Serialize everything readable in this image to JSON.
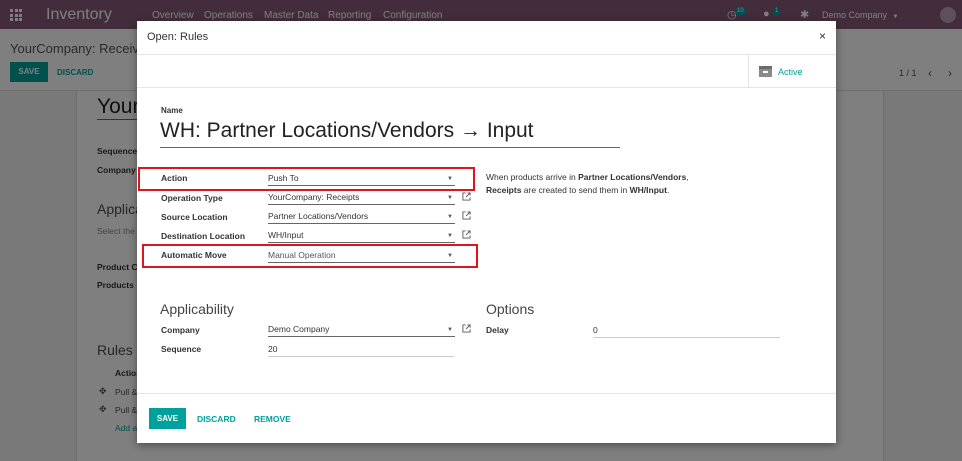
{
  "navbar": {
    "app_name": "Inventory",
    "menus": [
      "Overview",
      "Operations",
      "Master Data",
      "Reporting",
      "Configuration"
    ],
    "activity_count": "10",
    "messages_count": "1",
    "company": "Demo Company",
    "apps_icon": "grid-icon",
    "color": "#875a7b"
  },
  "background": {
    "breadcrumb": "YourCompany: Receive",
    "save_label": "SAVE",
    "discard_label": "DISCARD",
    "pager": "1 / 1",
    "heading_partial": "Your",
    "sequence_label": "Sequence",
    "company_label": "Company",
    "applic_partial": "Applica",
    "select_partial": "Select the",
    "product_cat_partial": "Product C",
    "products_label": "Products",
    "rules_title": "Rules",
    "action_col": "Action",
    "row1": "Pull &",
    "row2": "Pull &",
    "add_line": "Add a"
  },
  "modal": {
    "title": "Open: Rules",
    "close_glyph": "×",
    "active_label": "Active",
    "name_label": "Name",
    "name_value": "WH: Partner Locations/Vendors → Input",
    "fields": {
      "action": {
        "label": "Action",
        "value": "Push To"
      },
      "operation_type": {
        "label": "Operation Type",
        "value": "YourCompany: Receipts"
      },
      "source_location": {
        "label": "Source Location",
        "value": "Partner Locations/Vendors"
      },
      "destination_location": {
        "label": "Destination Location",
        "value": "WH/Input"
      },
      "automatic_move": {
        "label": "Automatic Move",
        "value": "Manual Operation"
      }
    },
    "help": {
      "t1": "When products arrive in ",
      "b1": "Partner Locations/Vendors",
      "t2": ",",
      "b2": "Receipts",
      "t3": " are created to send them in ",
      "b3": "WH/Input",
      "t4": "."
    },
    "applicability": {
      "title": "Applicability",
      "company": {
        "label": "Company",
        "value": "Demo Company"
      },
      "sequence": {
        "label": "Sequence",
        "value": "20"
      }
    },
    "options": {
      "title": "Options",
      "delay": {
        "label": "Delay",
        "value": "0"
      }
    },
    "footer": {
      "save": "SAVE",
      "discard": "DISCARD",
      "remove": "REMOVE"
    },
    "accent_color": "#00a09d",
    "highlight_color": "#e0141a"
  }
}
